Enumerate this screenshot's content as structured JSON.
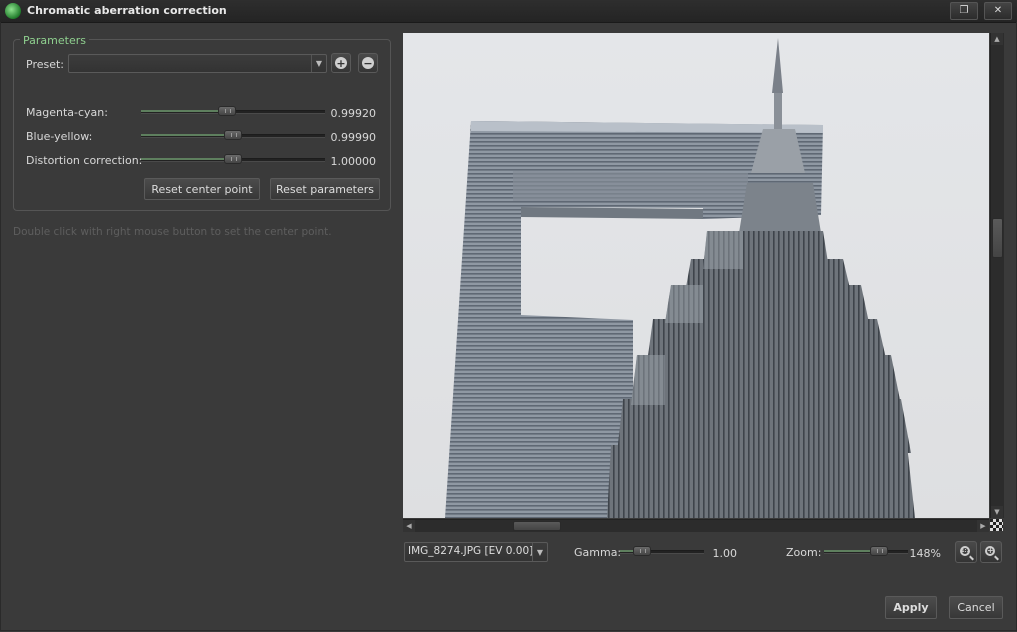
{
  "window": {
    "title": "Chromatic aberration correction",
    "restore_glyph": "❐",
    "close_glyph": "✕"
  },
  "parameters": {
    "legend": "Parameters",
    "preset_label": "Preset:",
    "preset_value": "",
    "add_glyph": "+",
    "remove_glyph": "−",
    "sliders": [
      {
        "label": "Magenta-cyan:",
        "value_text": "0.99920",
        "position": 0.47
      },
      {
        "label": "Blue-yellow:",
        "value_text": "0.99990",
        "position": 0.5
      },
      {
        "label": "Distortion correction:",
        "value_text": "1.00000",
        "position": 0.5
      }
    ],
    "reset_center_label": "Reset center point",
    "reset_params_label": "Reset parameters"
  },
  "hint": "Double click with right mouse button to set the center point.",
  "preview": {
    "image_icon": "skyscraper-photo"
  },
  "bottom": {
    "image_select": "IMG_8274.JPG [EV 0.00]",
    "gamma_label": "Gamma:",
    "gamma_value": "1.00",
    "gamma_position": 0.26,
    "zoom_label": "Zoom:",
    "zoom_value": "148%",
    "zoom_position": 0.65,
    "zoom_fit_glyph": "1:1",
    "zoom_in_glyph": "+"
  },
  "footer": {
    "apply_label": "Apply",
    "cancel_label": "Cancel"
  },
  "icons": {
    "app": "chromatic-aberration-app-icon",
    "scroll_up": "▲",
    "scroll_down": "▼",
    "scroll_left": "◀",
    "scroll_right": "▶",
    "combo_arrow": "▼"
  }
}
